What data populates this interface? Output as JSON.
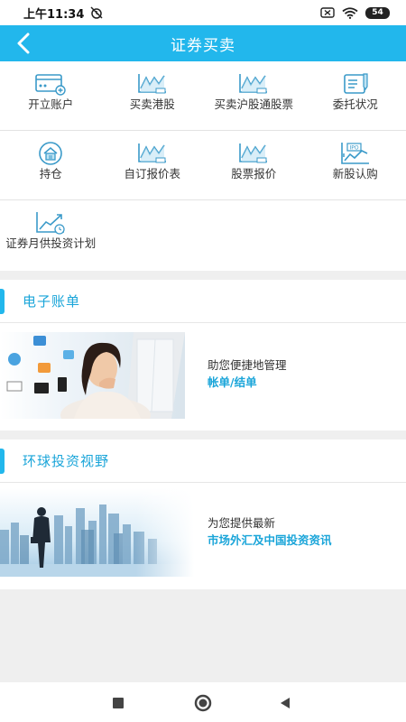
{
  "status_bar": {
    "time": "上午11:34",
    "battery": "54"
  },
  "header": {
    "title": "证券买卖"
  },
  "grid": {
    "rows": [
      [
        {
          "label": "开立账户",
          "icon": "card-icon"
        },
        {
          "label": "买卖港股",
          "icon": "chart-icon"
        },
        {
          "label": "买卖沪股通股票",
          "icon": "chart-icon"
        },
        {
          "label": "委托状况",
          "icon": "document-icon"
        }
      ],
      [
        {
          "label": "持仓",
          "icon": "house-icon"
        },
        {
          "label": "自订报价表",
          "icon": "chart-icon"
        },
        {
          "label": "股票报价",
          "icon": "chart-icon"
        },
        {
          "label": "新股认购",
          "icon": "ipo-icon"
        }
      ],
      [
        {
          "label": "证券月供投资计划",
          "icon": "growth-chart-icon"
        }
      ]
    ]
  },
  "sections": [
    {
      "title": "电子账单",
      "line1": "助您便捷地管理",
      "line2": "帐单/结单"
    },
    {
      "title": "环球投资视野",
      "line1": "为您提供最新",
      "line2": "市场外汇及中国投资资讯"
    }
  ],
  "colors": {
    "accent": "#22b7ec",
    "accent_text": "#1aa5d9"
  }
}
